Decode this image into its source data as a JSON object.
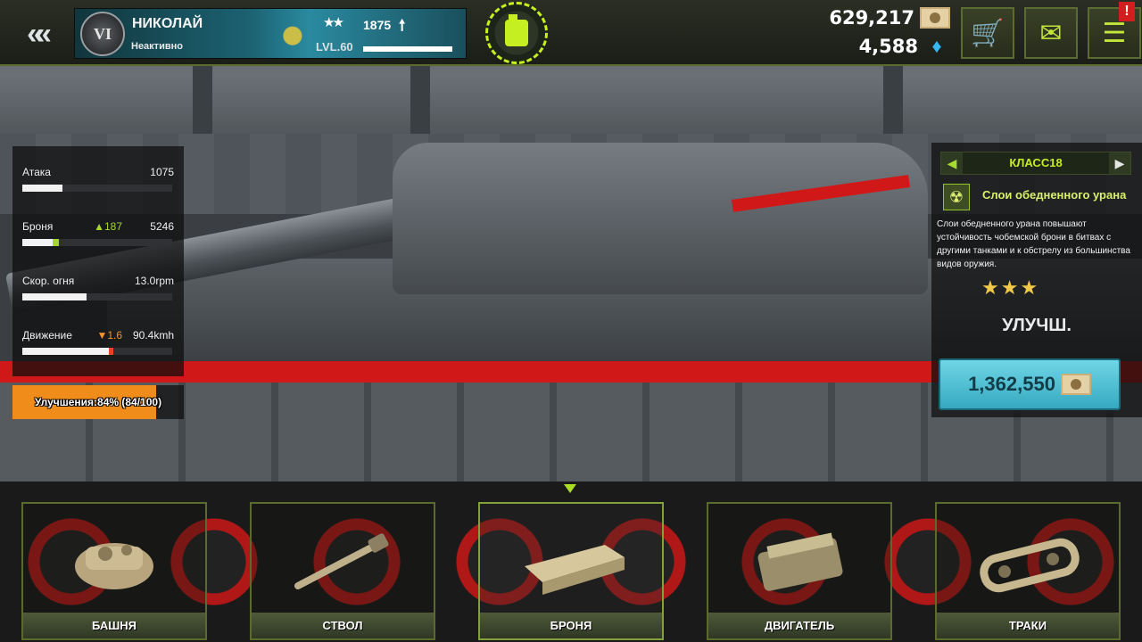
{
  "player": {
    "name": "НИКОЛАЙ",
    "status": "Неактивно",
    "rank_emblem": "VI",
    "level": "LVL.60",
    "xp": "1875",
    "xp_arrow": "🠕",
    "stars": "★★"
  },
  "currency": {
    "gold": "629,217",
    "gems": "4,588"
  },
  "icons": {
    "back": "«",
    "cart": "🛒",
    "mail": "✉",
    "chat": "☰",
    "alert": "!",
    "gem": "♦",
    "class_prev": "◀",
    "class_next": "▶",
    "module": "☢"
  },
  "stats": {
    "attack": {
      "label": "Атака",
      "value": "1075",
      "fill": 0.27
    },
    "armor": {
      "label": "Броня",
      "delta": "▲187",
      "value": "5246",
      "fill": 0.2,
      "bonus": 0.04
    },
    "fire_rate": {
      "label": "Скор. огня",
      "value": "13.0rpm",
      "fill": 0.43
    },
    "movement": {
      "label": "Движение",
      "delta": "▼1.6",
      "value": "90.4kmh",
      "fill": 0.58,
      "penalty": 0.03
    }
  },
  "upgrade_progress": {
    "text": "Улучшения:84% (84/100)",
    "percent": 84
  },
  "module": {
    "class_label": "КЛАСС18",
    "name": "Слои обедненного урана",
    "description": "Слои обедненного урана повышают устойчивость чобемской брони в битвах с другими танками и к обстрелу из большинства видов оружия.",
    "stars": "★★★",
    "upgrade_label": "УЛУЧШ.",
    "price": "1,362,550"
  },
  "tabs": [
    {
      "label": "БАШНЯ"
    },
    {
      "label": "СТВОЛ"
    },
    {
      "label": "БРОНЯ"
    },
    {
      "label": "ДВИГАТЕЛЬ"
    },
    {
      "label": "ТРАКИ"
    }
  ],
  "selected_tab": 2,
  "colors": {
    "accent_green": "#a9de24",
    "upgrade_orange": "#f08c1a",
    "price_cyan": "#4fc3d8",
    "stripe_red": "#d01818"
  }
}
